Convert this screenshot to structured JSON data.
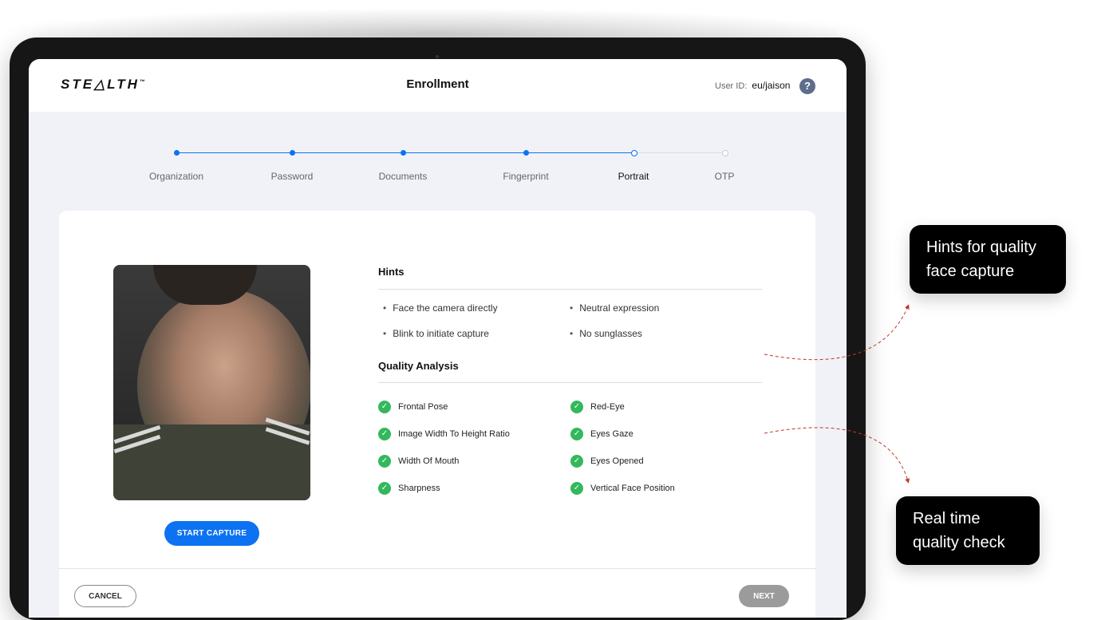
{
  "app": {
    "logo": "STE△LTH",
    "logo_tm": "™",
    "title": "Enrollment"
  },
  "user": {
    "label": "User ID:",
    "value": "eu/jaison",
    "help": "?"
  },
  "steps": [
    {
      "label": "Organization",
      "state": "done"
    },
    {
      "label": "Password",
      "state": "done"
    },
    {
      "label": "Documents",
      "state": "done"
    },
    {
      "label": "Fingerprint",
      "state": "done"
    },
    {
      "label": "Portrait",
      "state": "current"
    },
    {
      "label": "OTP",
      "state": "todo"
    }
  ],
  "hints": {
    "title": "Hints",
    "items": [
      "Face the camera directly",
      "Neutral expression",
      "Blink to initiate capture",
      "No sunglasses"
    ]
  },
  "quality": {
    "title": "Quality Analysis",
    "items": [
      "Frontal Pose",
      "Red-Eye",
      "Image Width To Height Ratio",
      "Eyes Gaze",
      "Width Of Mouth",
      "Eyes Opened",
      "Sharpness",
      "Vertical Face Position"
    ]
  },
  "capture": {
    "start_label": "START CAPTURE"
  },
  "footer": {
    "cancel_label": "CANCEL",
    "next_label": "NEXT"
  },
  "callouts": {
    "hints": [
      "Hints for quality",
      "face capture"
    ],
    "quality": [
      "Real time",
      "quality check"
    ]
  },
  "colors": {
    "accent": "#0d72f2",
    "success": "#33b85c",
    "disabled": "#9b9b9b",
    "annotation": "#c0392b"
  },
  "icons": {
    "help": "help-icon",
    "check": "check-circle-icon"
  }
}
